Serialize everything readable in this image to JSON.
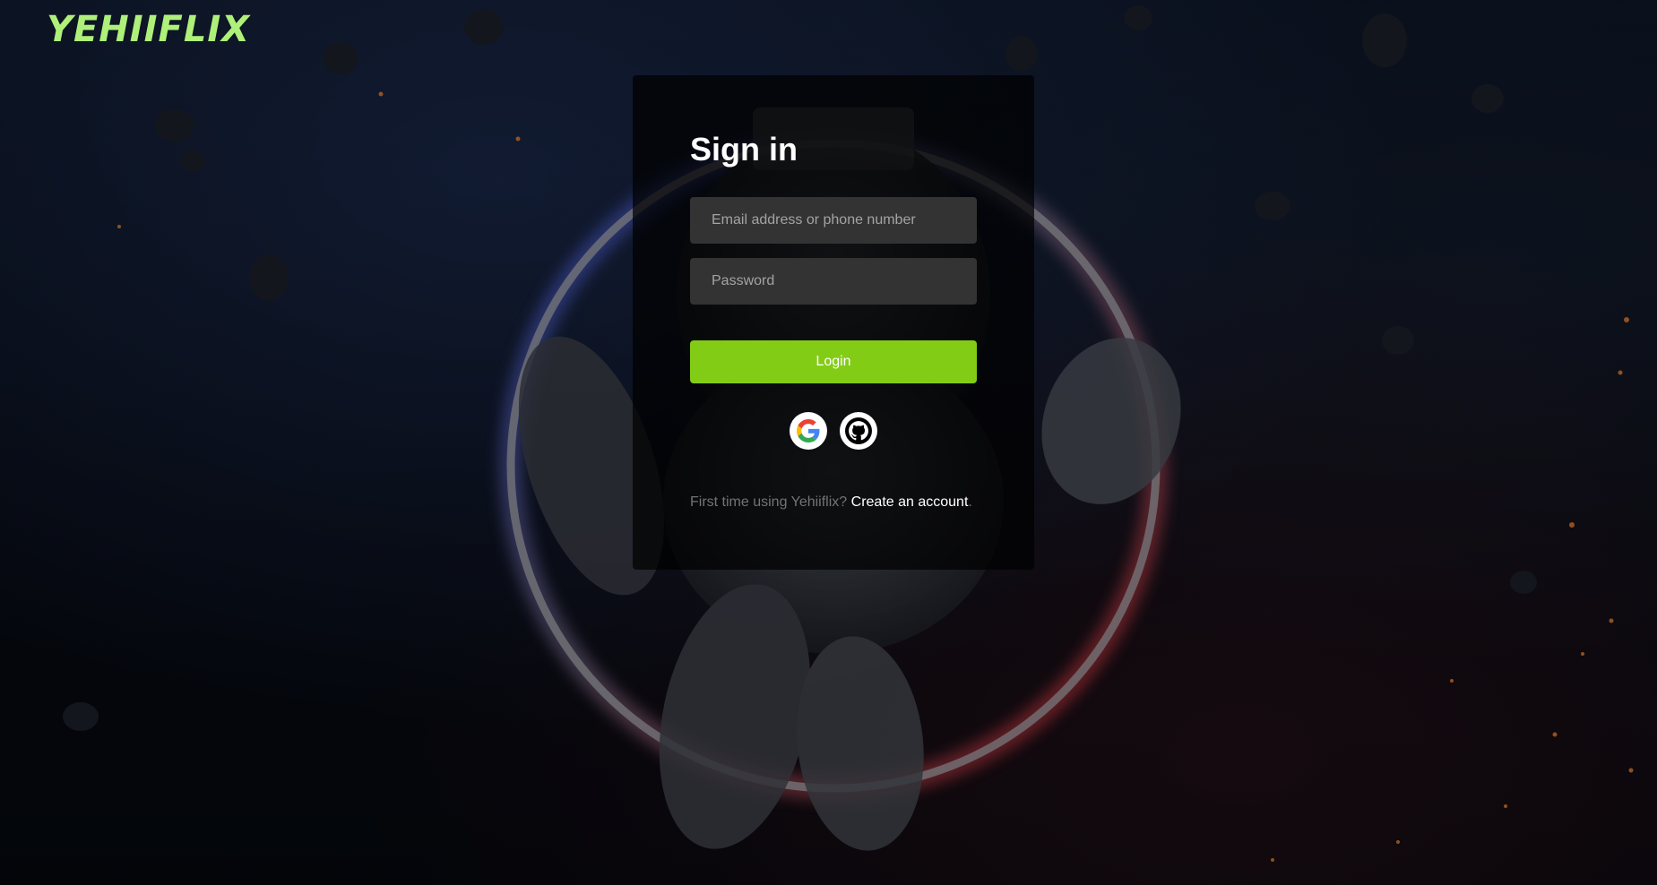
{
  "brand": {
    "logo_text": "YEHIIFLIX",
    "accent_color": "#aef07a",
    "button_color": "#83cc16"
  },
  "signin": {
    "title": "Sign in",
    "email_placeholder": "Email address or phone number",
    "password_placeholder": "Password",
    "login_label": "Login"
  },
  "social": [
    {
      "icon": "google-icon"
    },
    {
      "icon": "github-icon"
    }
  ],
  "footer": {
    "prompt": "First time using Yehiiflix?",
    "create_link": "Create an account",
    "punctuation": "."
  }
}
